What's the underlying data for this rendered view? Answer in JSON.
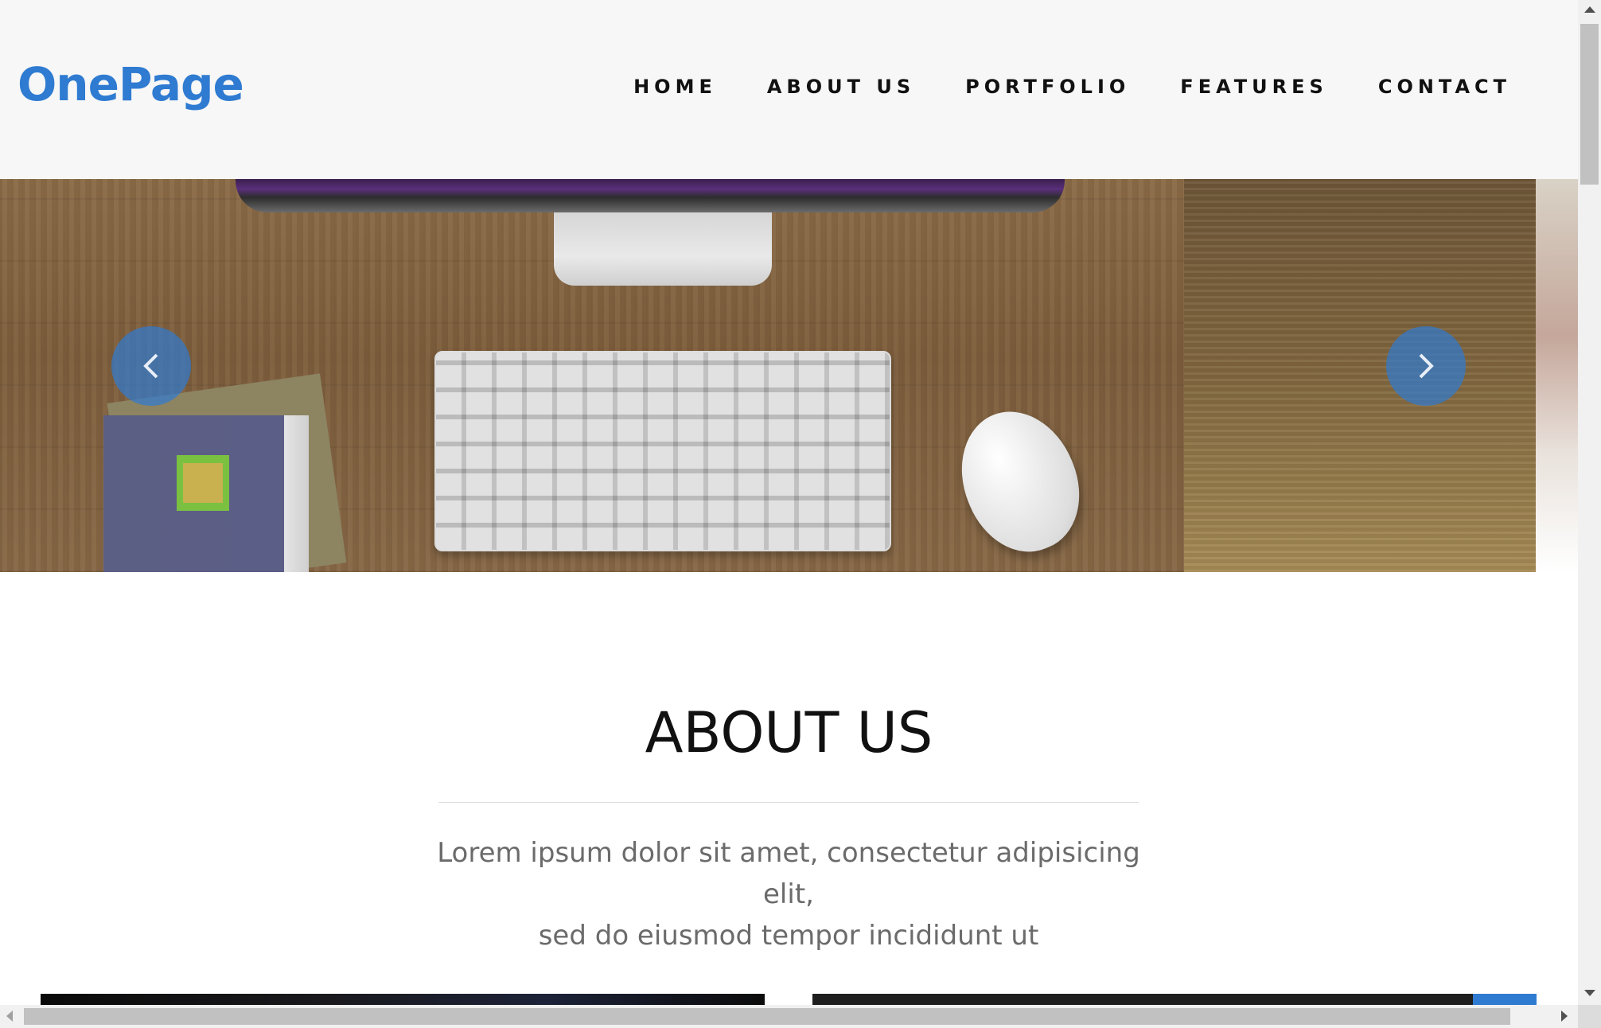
{
  "header": {
    "logo": "OnePage",
    "nav": [
      "HOME",
      "ABOUT US",
      "PORTFOLIO",
      "FEATURES",
      "CONTACT"
    ]
  },
  "hero": {
    "prev_icon": "chevron-left-icon",
    "next_icon": "chevron-right-icon"
  },
  "about": {
    "title": "ABOUT US",
    "text_line1": "Lorem ipsum dolor sit amet, consectetur adipisicing elit,",
    "text_line2": "sed do eiusmod tempor incididunt ut"
  },
  "colors": {
    "accent": "#2f7bd1",
    "header_bg": "#f7f7f7",
    "text_dark": "#111111",
    "text_muted": "#6b6b6b"
  }
}
